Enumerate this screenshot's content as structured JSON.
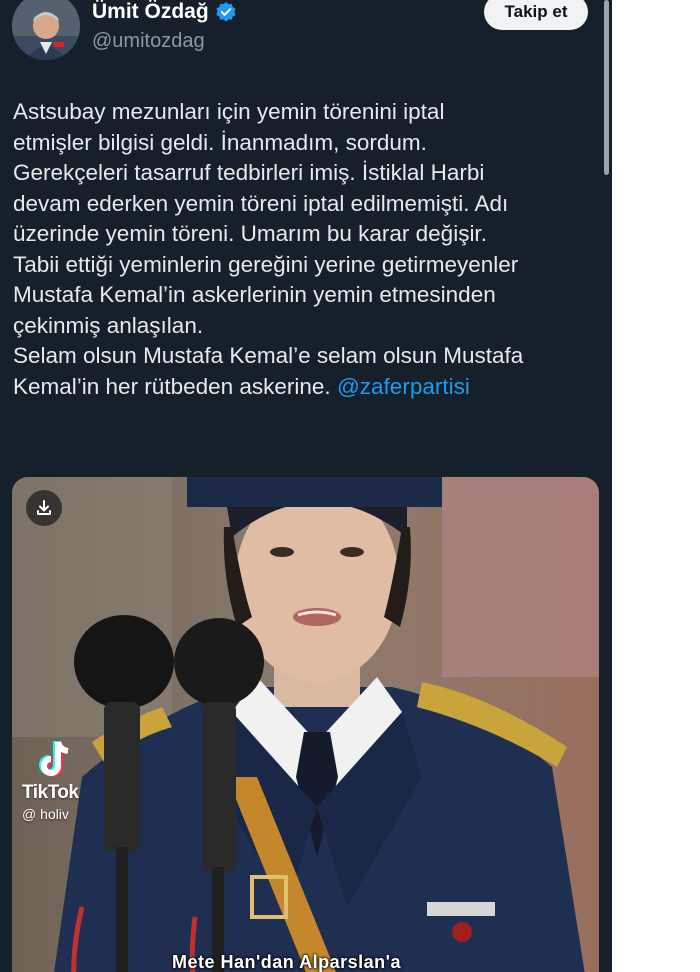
{
  "author": {
    "name": "Ümit Özdağ",
    "handle": "@umitozdag",
    "verified_color": "#1d9bf0"
  },
  "follow_button": {
    "label": "Takip et"
  },
  "tweet": {
    "lines": [
      "Astsubay mezunları için yemin törenini iptal",
      "etmişler bilgisi geldi. İnanmadım, sordum.",
      "Gerekçeleri tasarruf tedbirleri imiş. İstiklal Harbi",
      "devam ederken yemin töreni iptal edilmemişti. Adı",
      "üzerinde yemin töreni. Umarım bu karar değişir.",
      "Tabii ettiği yeminlerin gereğini yerine getirmeyenler",
      "Mustafa Kemal’in askerlerinin yemin etmesinden",
      "çekinmiş anlaşılan.",
      "Selam olsun Mustafa Kemal’e selam olsun Mustafa",
      "Kemal’in her rütbeden askerine."
    ],
    "mention": "@zaferpartisi",
    "mention_color": "#1d9bf0"
  },
  "media": {
    "download_icon": "download-icon",
    "watermark": {
      "brand": "TikTok",
      "user": "@ holiv"
    },
    "caption": "Mete Han'dan Alparslan'a"
  },
  "colors": {
    "background": "#15202b",
    "text": "#e7e9ea",
    "secondary_text": "#8899a6"
  }
}
